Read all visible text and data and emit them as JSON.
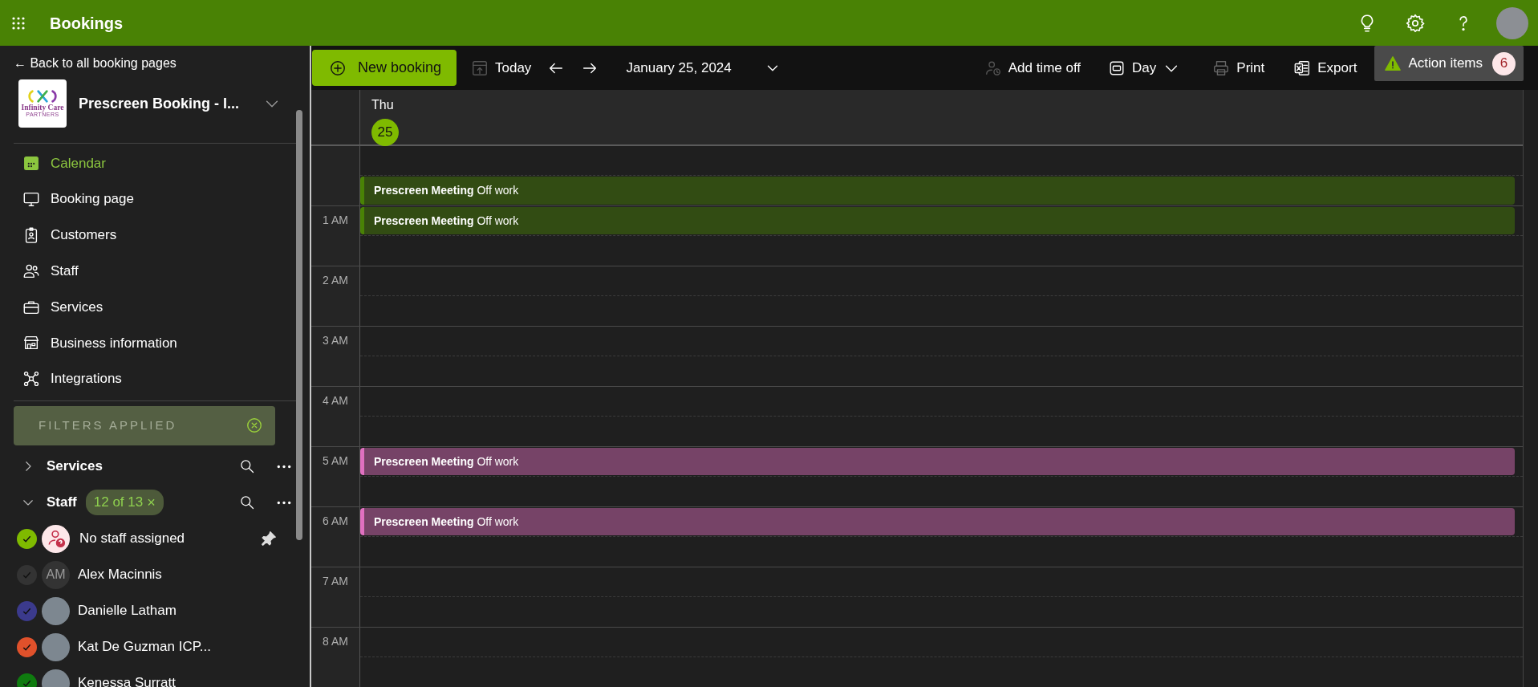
{
  "app_bar": {
    "title": "Bookings"
  },
  "sidebar": {
    "back_link": "← Back to all booking pages",
    "business": {
      "logo_text": "Infinity Care",
      "logo_subtext": "PARTNERS",
      "name": "Prescreen Booking - I..."
    },
    "nav": [
      {
        "label": "Calendar",
        "selected": true
      },
      {
        "label": "Booking page",
        "selected": false
      },
      {
        "label": "Customers",
        "selected": false
      },
      {
        "label": "Staff",
        "selected": false
      },
      {
        "label": "Services",
        "selected": false
      },
      {
        "label": "Business information",
        "selected": false
      },
      {
        "label": "Integrations",
        "selected": false
      }
    ],
    "filters_banner": "FILTERS APPLIED",
    "services_group": {
      "label": "Services",
      "expanded": false
    },
    "staff_group": {
      "label": "Staff",
      "expanded": true,
      "chip": "12 of 13",
      "chip_close": "×"
    },
    "staff": [
      {
        "name": "No staff assigned",
        "checked": true,
        "color": "#7fba00",
        "kind": "unassigned",
        "pinned": true
      },
      {
        "name": "Alex Macinnis",
        "checked": true,
        "color": "#333333",
        "kind": "initials",
        "initials": "AM",
        "pinned": false
      },
      {
        "name": "Danielle Latham",
        "checked": true,
        "color": "#3b3a8c",
        "kind": "photo",
        "pinned": false
      },
      {
        "name": "Kat De Guzman ICP...",
        "checked": true,
        "color": "#e0512b",
        "kind": "photo",
        "pinned": false
      },
      {
        "name": "Kenessa Surratt",
        "checked": true,
        "color": "#0f7b0f",
        "kind": "photo",
        "pinned": false
      }
    ]
  },
  "toolbar": {
    "new_booking": "New booking",
    "today": "Today",
    "date": "January 25, 2024",
    "add_time_off": "Add time off",
    "view": "Day",
    "print": "Print",
    "export": "Export",
    "action_items": {
      "label": "Action items",
      "count": "6"
    }
  },
  "calendar": {
    "day": {
      "weekday": "Thu",
      "date": "25"
    },
    "hours": [
      {
        "second_half": {
          "title": "Prescreen Meeting",
          "subtitle": "Off work",
          "color": "#498205"
        }
      },
      {
        "label": "1 AM",
        "first_half": {
          "title": "Prescreen Meeting",
          "subtitle": "Off work",
          "color": "#498205"
        }
      },
      {
        "label": "2 AM"
      },
      {
        "label": "3 AM"
      },
      {
        "label": "4 AM"
      },
      {
        "label": "5 AM",
        "first_half": {
          "title": "Prescreen Meeting",
          "subtitle": "Off work",
          "color": "#e070c0"
        }
      },
      {
        "label": "6 AM",
        "first_half": {
          "title": "Prescreen Meeting",
          "subtitle": "Off work",
          "color": "#e070c0"
        }
      },
      {
        "label": "7 AM"
      },
      {
        "label": "8 AM"
      }
    ]
  }
}
